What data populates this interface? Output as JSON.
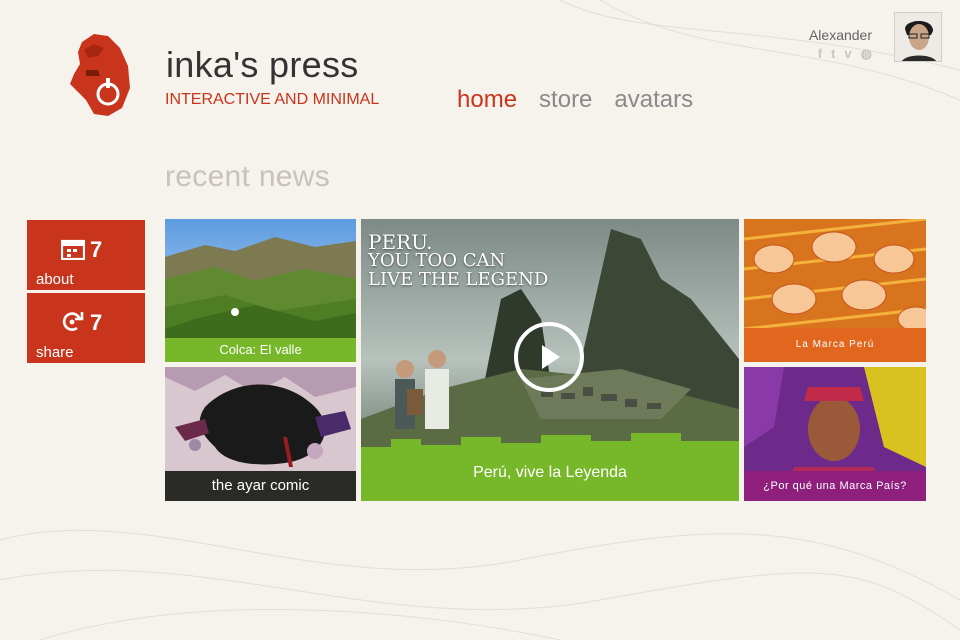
{
  "brand": {
    "title": "inka's press",
    "tagline": "INTERACTIVE AND MINIMAL",
    "accent_color": "#c9351c"
  },
  "nav": {
    "items": [
      {
        "label": "home",
        "active": true
      },
      {
        "label": "store",
        "active": false
      },
      {
        "label": "avatars",
        "active": false
      }
    ]
  },
  "user": {
    "name": "Alexander",
    "social": [
      {
        "icon": "facebook-icon",
        "glyph": "f"
      },
      {
        "icon": "twitter-icon",
        "glyph": "t"
      },
      {
        "icon": "vimeo-icon",
        "glyph": "v"
      },
      {
        "icon": "dribbble-icon",
        "glyph": "◍"
      }
    ]
  },
  "section_title": "recent news",
  "side_tiles": [
    {
      "label": "about",
      "count": "7",
      "icon": "calendar-icon"
    },
    {
      "label": "share",
      "count": "7",
      "icon": "share-icon"
    }
  ],
  "tiles": {
    "colca": {
      "caption": "Colca: El valle"
    },
    "ayar": {
      "caption": "the ayar comic"
    },
    "hero": {
      "caption": "Perú, vive la Leyenda",
      "headline_1": "PERU.",
      "headline_2": "YOU TOO CAN",
      "headline_3": "LIVE THE LEGEND"
    },
    "marca": {
      "caption": "La Marca Perú"
    },
    "pais": {
      "caption": "¿Por qué una Marca País?"
    }
  }
}
